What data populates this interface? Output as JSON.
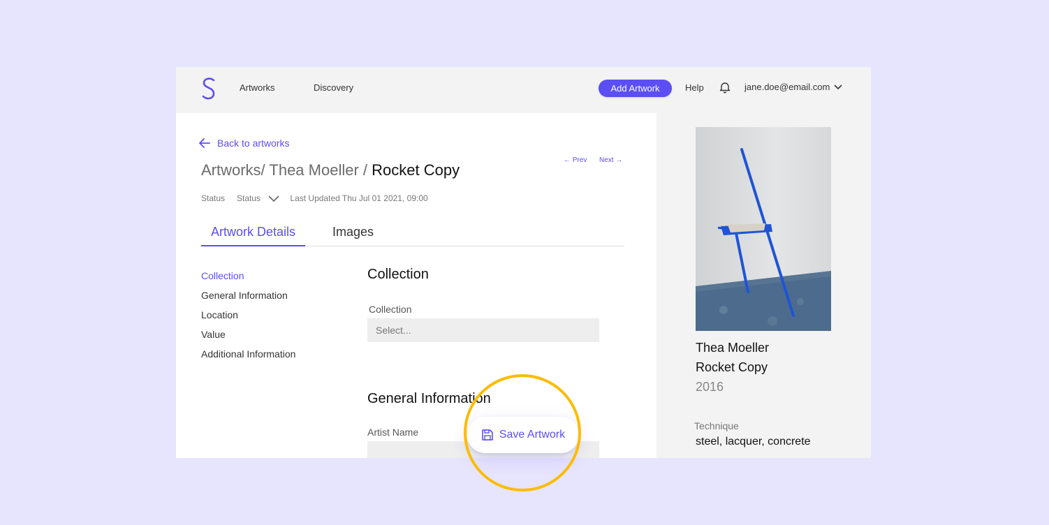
{
  "nav": {
    "logo": "S",
    "links": [
      "Artworks",
      "Discovery"
    ],
    "add_button": "Add Artwork",
    "help": "Help",
    "user_email": "jane.doe@email.com"
  },
  "header": {
    "back_link": "Back to artworks",
    "breadcrumb_prefix": "Artworks/ Thea Moeller / ",
    "breadcrumb_current": "Rocket Copy",
    "prev": "Prev",
    "next": "Next",
    "status_label": "Status",
    "status_value": "Status",
    "last_updated": "Last Updated Thu Jul 01 2021, 09:00"
  },
  "tabs": [
    "Artwork Details",
    "Images"
  ],
  "side_nav": [
    "Collection",
    "General Information",
    "Location",
    "Value",
    "Additional Information"
  ],
  "form": {
    "collection_title": "Collection",
    "collection_label": "Collection",
    "collection_placeholder": "Select...",
    "general_title": "General Information",
    "artist_label": "Artist Name"
  },
  "artwork": {
    "artist": "Thea Moeller",
    "title": "Rocket Copy",
    "year": "2016",
    "technique_label": "Technique",
    "technique_value": "steel, lacquer, concrete"
  },
  "save_button": "Save Artwork",
  "colors": {
    "accent": "#5b4ef5",
    "background": "#e7e4fd",
    "highlight": "#fbbc05"
  }
}
